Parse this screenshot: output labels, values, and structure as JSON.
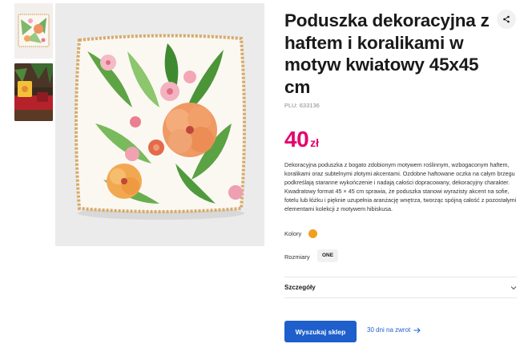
{
  "product": {
    "title": "Poduszka dekoracyjna z haftem i koralikami w motyw kwiatowy 45x45 cm",
    "plu": "PLU: 633136",
    "price_amount": "40",
    "price_currency": "zł",
    "description": "Dekoracyjna poduszka z bogato zdobionym motywem roślinnym, wzbogaconym haftem, koralikami oraz subtelnymi złotymi akcentami. Ozdobne haftowane oczka na całym brzegu podkreślają staranne wykończenie i nadają całości dopracowany, dekoracyjny charakter. Kwadratowy format 45 × 45 cm sprawia, że poduszka stanowi wyrazisty akcent na sofie, fotelu lub łóżku i pięknie uzupełnia aranżację wnętrza, tworząc spójną całość z pozostałymi elementami kolekcji z motywem hibiskusa."
  },
  "options": {
    "colors_label": "Kolory",
    "color_swatch": "#f0a01e",
    "sizes_label": "Rozmiary",
    "size_value": "ONE"
  },
  "details": {
    "label": "Szczegóły"
  },
  "actions": {
    "find_store": "Wyszukaj sklep",
    "returns": "30 dni na zwrot"
  },
  "icons": {
    "share": "share-icon",
    "chevron": "chevron-down-icon",
    "arrow": "arrow-right-icon"
  },
  "colors": {
    "price": "#e5006d",
    "accent": "#1e5fcc"
  }
}
